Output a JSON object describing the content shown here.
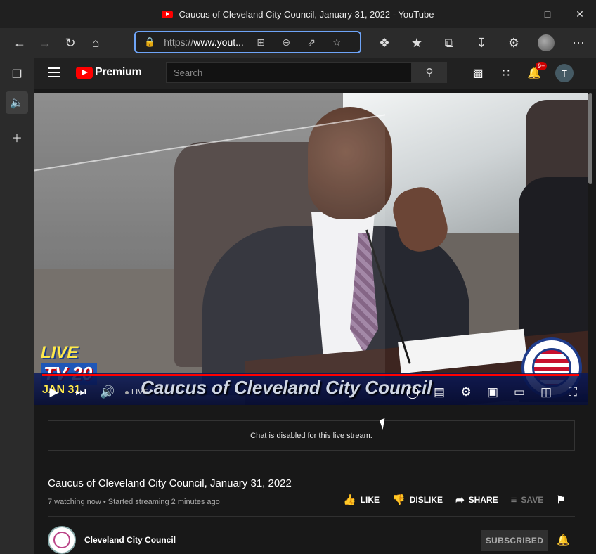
{
  "window": {
    "title": "Caucus of Cleveland City Council, January 31, 2022 - YouTube"
  },
  "address_bar": {
    "url_prefix": "https://",
    "url_host": "www.yout..."
  },
  "youtube": {
    "brand": "Premium",
    "search_placeholder": "Search",
    "notification_count": "9+",
    "avatar_letter": "T"
  },
  "video": {
    "live_logo_line1": "LIVE",
    "live_logo_line2": "TV 20",
    "banner_text": "Caucus of Cleveland City Council",
    "banner_date": "JAN 31",
    "live_label": "LIVE",
    "progress": 1.0
  },
  "chat": {
    "message": "Chat is disabled for this live stream."
  },
  "info": {
    "title": "Caucus of Cleveland City Council, January 31, 2022",
    "meta": "7 watching now • Started streaming 2 minutes ago",
    "like": "LIKE",
    "dislike": "DISLIKE",
    "share": "SHARE",
    "save": "SAVE"
  },
  "channel": {
    "name": "Cleveland City Council",
    "subscribe_label": "SUBSCRIBED"
  },
  "colors": {
    "accent": "#ff0000",
    "address_focus": "#6ea4f7",
    "badge": "#cc0000"
  }
}
